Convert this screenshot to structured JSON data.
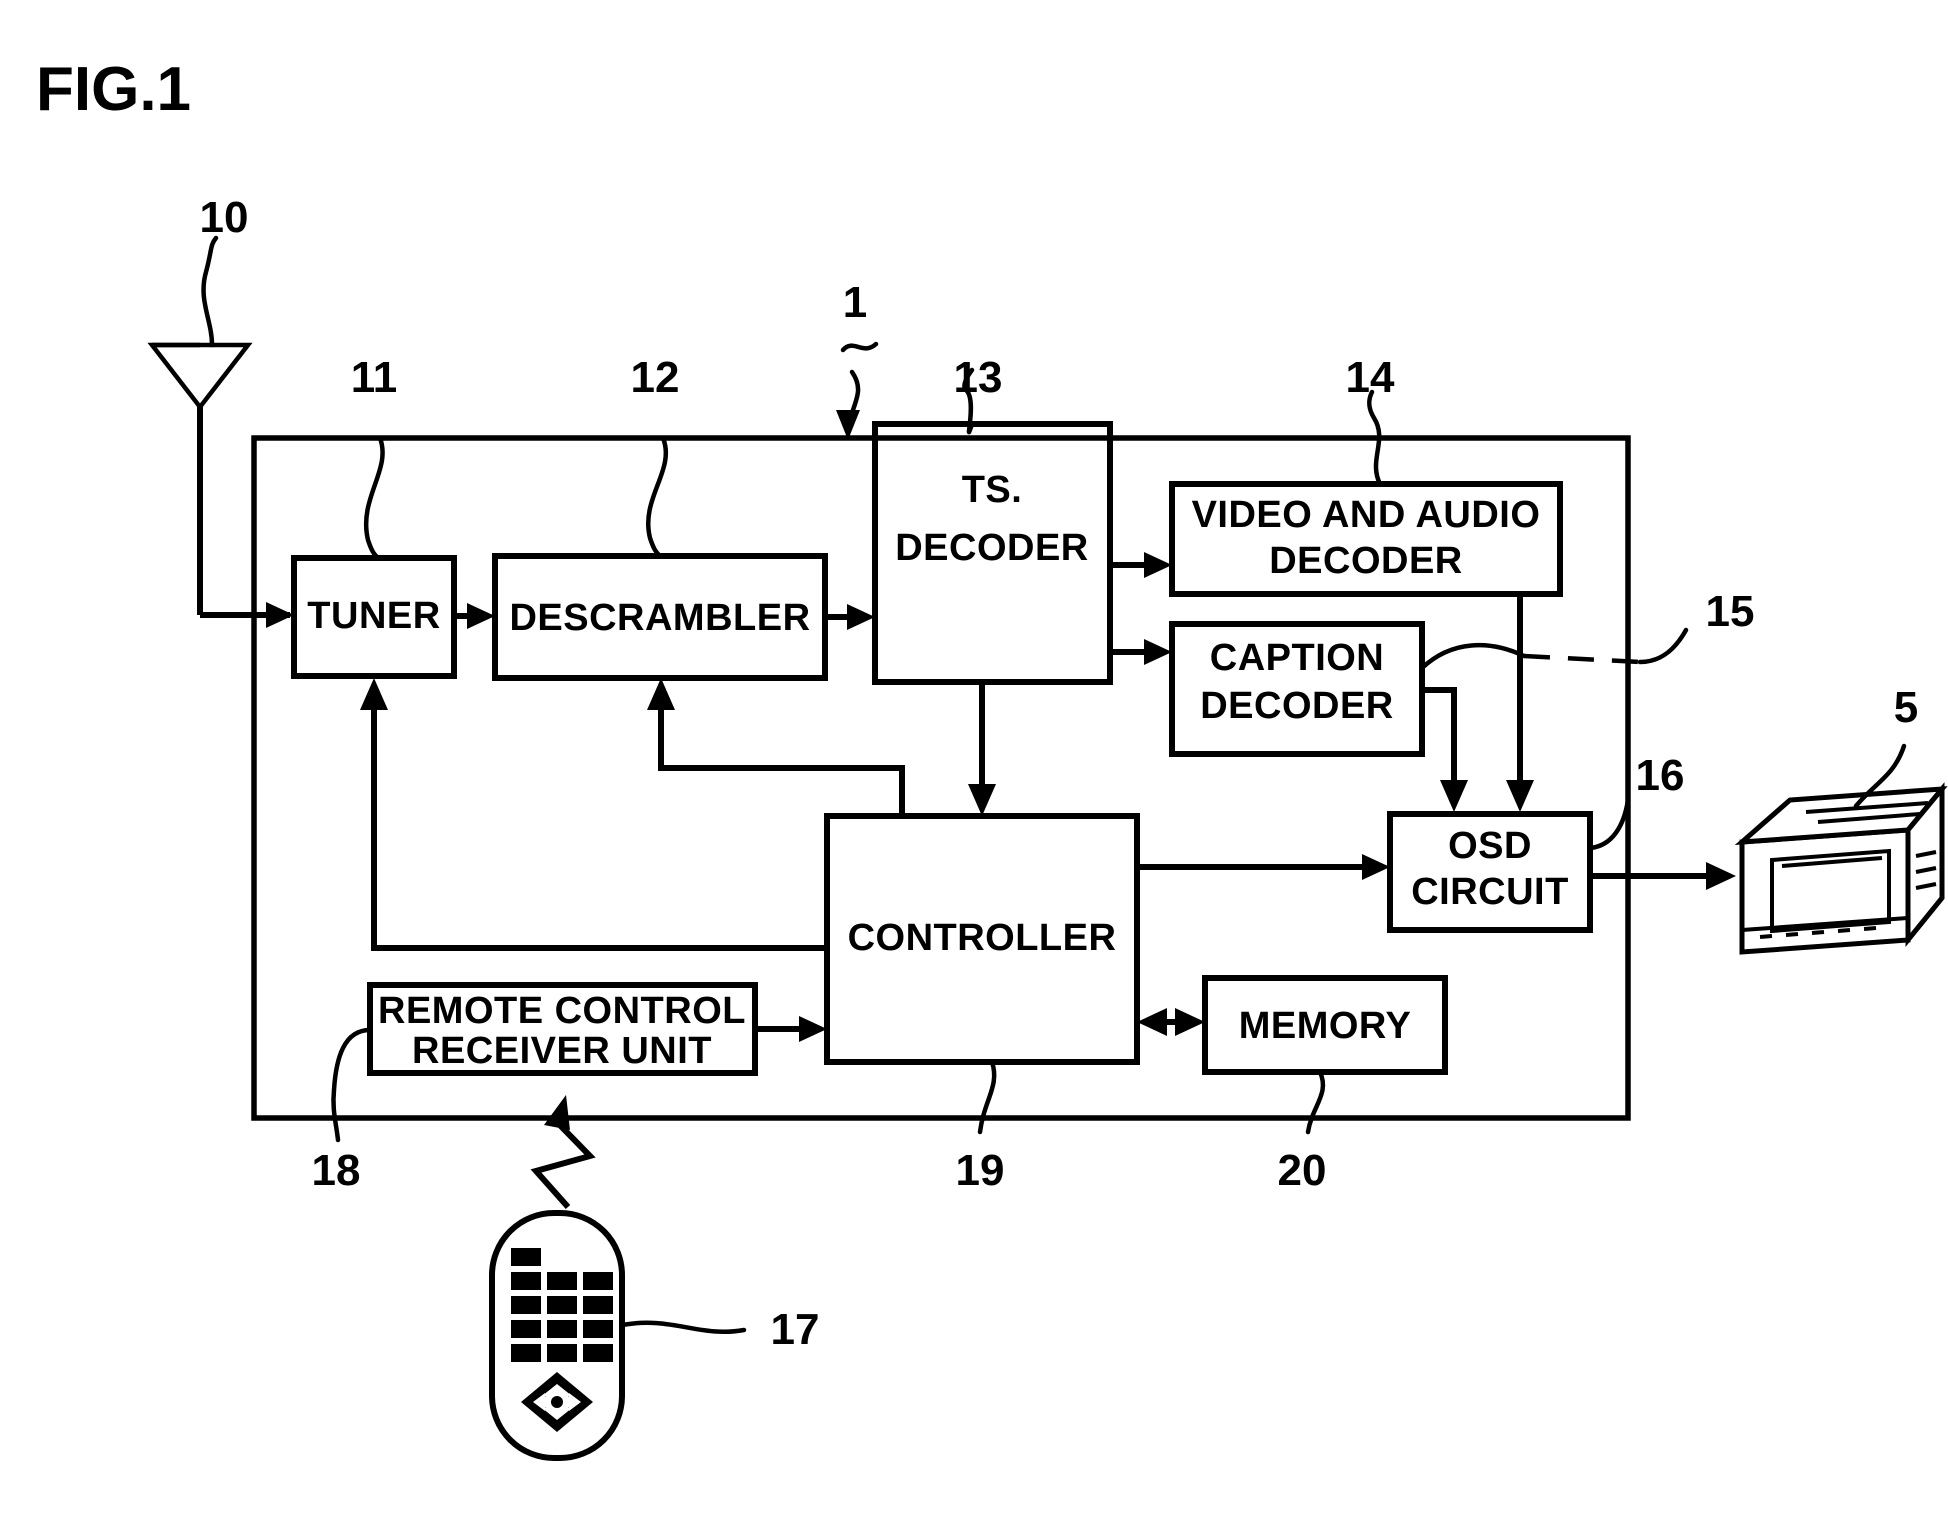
{
  "figure": {
    "title": "FIG.1",
    "type": "patent-block-diagram"
  },
  "blocks": [
    {
      "id": "tuner",
      "label": "TUNER",
      "ref": "11"
    },
    {
      "id": "descrambler",
      "label": "DESCRAMBLER",
      "ref": "12"
    },
    {
      "id": "ts_decoder",
      "label_line1": "TS.",
      "label_line2": "DECODER",
      "ref": "13"
    },
    {
      "id": "av_decoder",
      "label_line1": "VIDEO AND AUDIO",
      "label_line2": "DECODER",
      "ref": "14"
    },
    {
      "id": "caption",
      "label_line1": "CAPTION",
      "label_line2": "DECODER",
      "ref": "15"
    },
    {
      "id": "osd",
      "label_line1": "OSD",
      "label_line2": "CIRCUIT",
      "ref": "16"
    },
    {
      "id": "controller",
      "label": "CONTROLLER",
      "ref": "19"
    },
    {
      "id": "memory",
      "label": "MEMORY",
      "ref": "20"
    },
    {
      "id": "remote_rx",
      "label_line1": "REMOTE CONTROL",
      "label_line2": "RECEIVER UNIT",
      "ref": "18"
    }
  ],
  "components": [
    {
      "id": "antenna",
      "name": "antenna",
      "ref": "10"
    },
    {
      "id": "receiver",
      "name": "receiver-enclosure",
      "ref": "1"
    },
    {
      "id": "monitor",
      "name": "television-monitor",
      "ref": "5"
    },
    {
      "id": "remote",
      "name": "remote-controller",
      "ref": "17"
    }
  ],
  "reference_numerals": {
    "antenna": "10",
    "receiver": "1",
    "tuner": "11",
    "descrambler": "12",
    "ts_decoder": "13",
    "av_decoder": "14",
    "caption_decoder": "15",
    "osd_circuit": "16",
    "remote_controller": "17",
    "remote_receiver_unit": "18",
    "controller": "19",
    "memory": "20",
    "monitor": "5"
  },
  "labels": {
    "tuner": "TUNER",
    "descrambler": "DESCRAMBLER",
    "ts_decoder_1": "TS.",
    "ts_decoder_2": "DECODER",
    "av_decoder_1": "VIDEO AND AUDIO",
    "av_decoder_2": "DECODER",
    "caption_1": "CAPTION",
    "caption_2": "DECODER",
    "osd_1": "OSD",
    "osd_2": "CIRCUIT",
    "controller": "CONTROLLER",
    "memory": "MEMORY",
    "remote_rx_1": "REMOTE CONTROL",
    "remote_rx_2": "RECEIVER UNIT"
  },
  "colors": {
    "ink": "#000000",
    "paper": "#ffffff"
  }
}
